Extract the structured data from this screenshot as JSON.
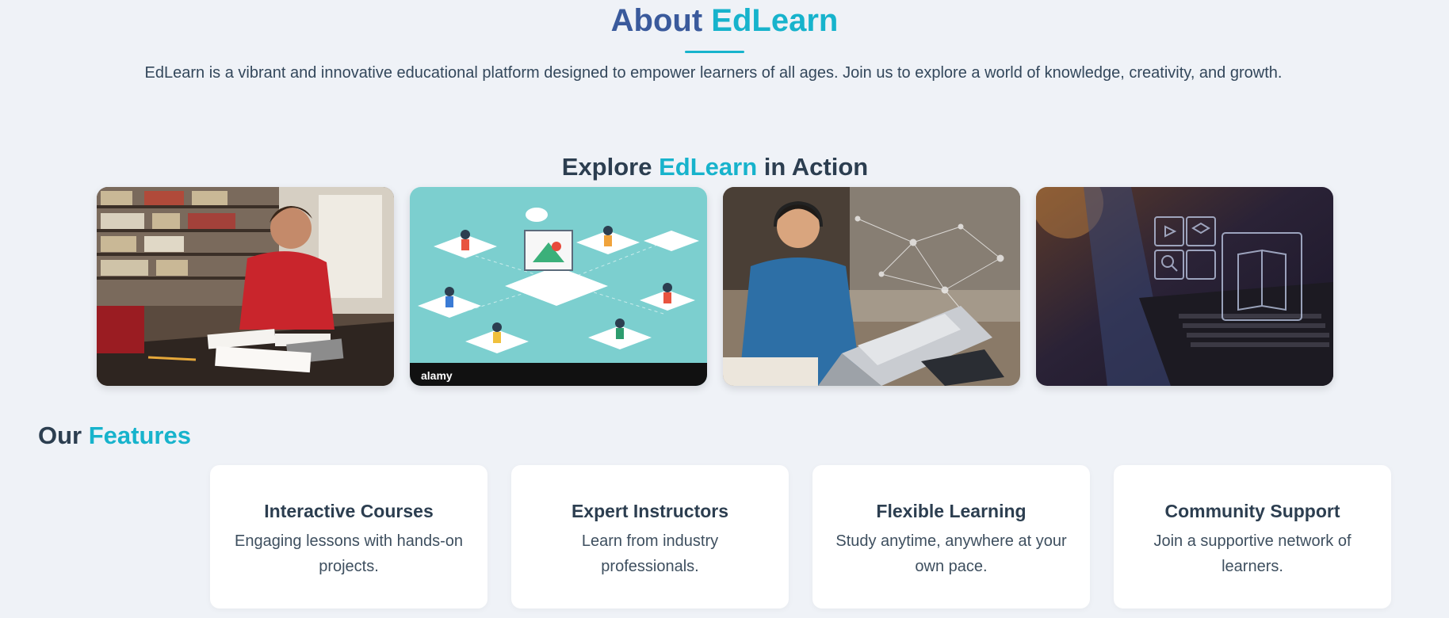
{
  "about": {
    "title_prefix": "About",
    "title_accent": "EdLearn",
    "description": "EdLearn is a vibrant and innovative educational platform designed to empower learners of all ages. Join us to explore a world of knowledge, creativity, and growth."
  },
  "explore": {
    "title_prefix": "Explore",
    "title_accent": "EdLearn",
    "title_suffix": "in Action",
    "images": [
      {
        "icon": "student-studying-library-image"
      },
      {
        "icon": "online-classroom-illustration-image",
        "watermark": "alamy"
      },
      {
        "icon": "student-headset-laptop-network-image"
      },
      {
        "icon": "laptop-elearning-icons-image"
      }
    ]
  },
  "features": {
    "title_prefix": "Our",
    "title_accent": "Features",
    "items": [
      {
        "title": "Interactive Courses",
        "text": "Engaging lessons with hands-on projects."
      },
      {
        "title": "Expert Instructors",
        "text": "Learn from industry professionals."
      },
      {
        "title": "Flexible Learning",
        "text": "Study anytime, anywhere at your own pace."
      },
      {
        "title": "Community Support",
        "text": "Join a supportive network of learners."
      }
    ]
  },
  "colors": {
    "background": "#eff2f7",
    "accent": "#17b3cc",
    "heading": "#2c3e50",
    "about_heading": "#3a5a9c"
  }
}
